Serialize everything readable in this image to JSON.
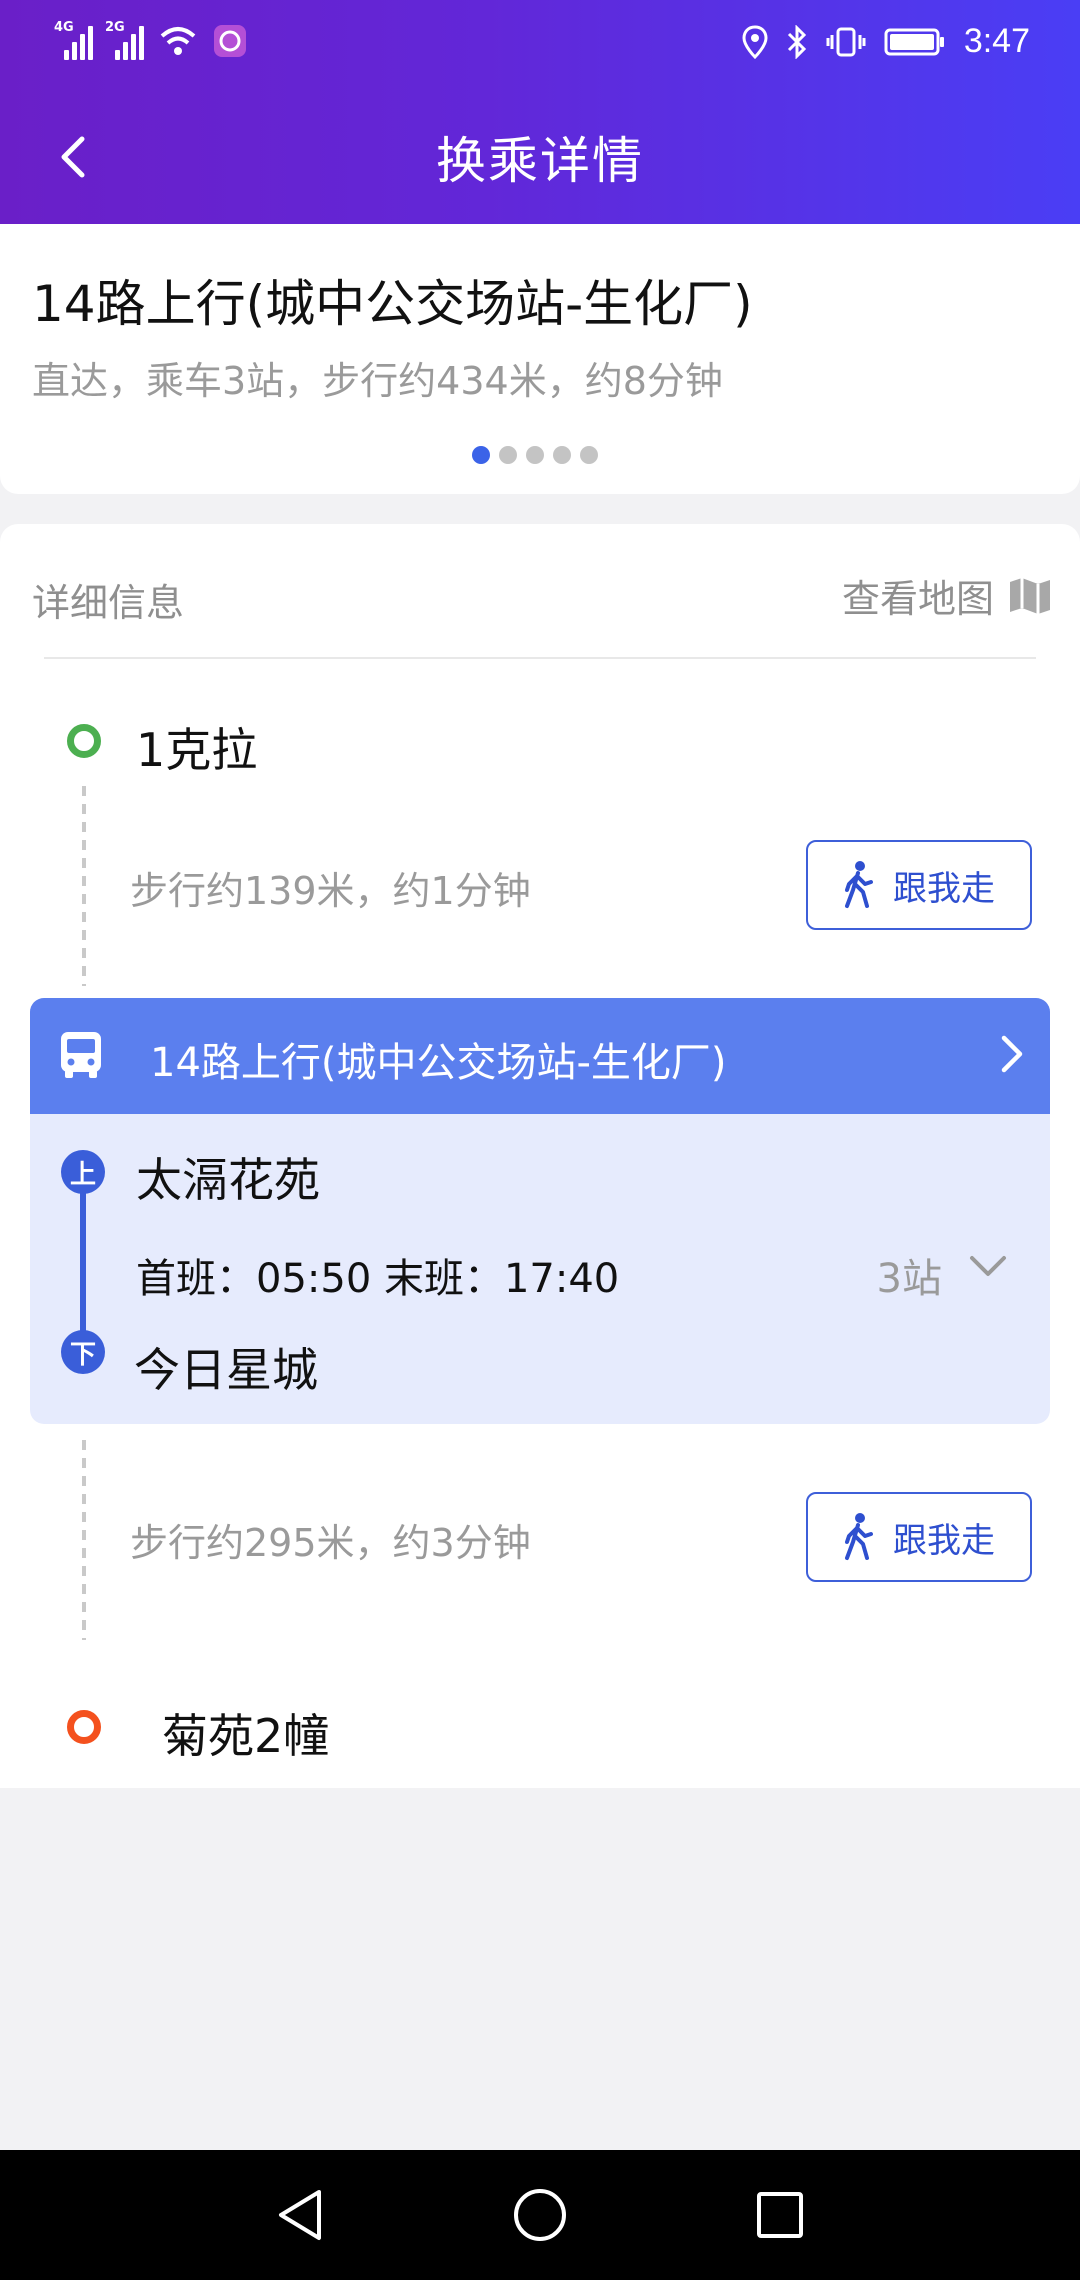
{
  "status_bar": {
    "signal1_label": "4G",
    "signal2_label": "2G",
    "time": "3:47"
  },
  "app_bar": {
    "title": "换乘详情",
    "back_icon": "chevron-left-icon"
  },
  "summary": {
    "route_title": "14路上行(城中公交场站-生化厂)",
    "description": "直达，乘车3站，步行约434米，约8分钟",
    "page_count": 5,
    "active_page": 1
  },
  "detail": {
    "label": "详细信息",
    "map_link": "查看地图",
    "start_stop": "1克拉",
    "walk1": {
      "text": "步行约139米，约1分钟",
      "button": "跟我走"
    },
    "bus": {
      "line": "14路上行(城中公交场站-生化厂)",
      "board_badge": "上",
      "alight_badge": "下",
      "board_stop": "太滆花苑",
      "schedule": "首班：05:50 末班：17:40",
      "stop_count": "3站",
      "alight_stop": "今日星城"
    },
    "walk2": {
      "text": "步行约295米，约3分钟",
      "button": "跟我走"
    },
    "end_stop": "菊苑2幢"
  },
  "colors": {
    "accent_blue": "#3b63e8",
    "bus_header": "#5b7fee",
    "bus_card_bg": "#e6ebfd",
    "start_green": "#4caf50",
    "end_orange": "#f4511e"
  }
}
